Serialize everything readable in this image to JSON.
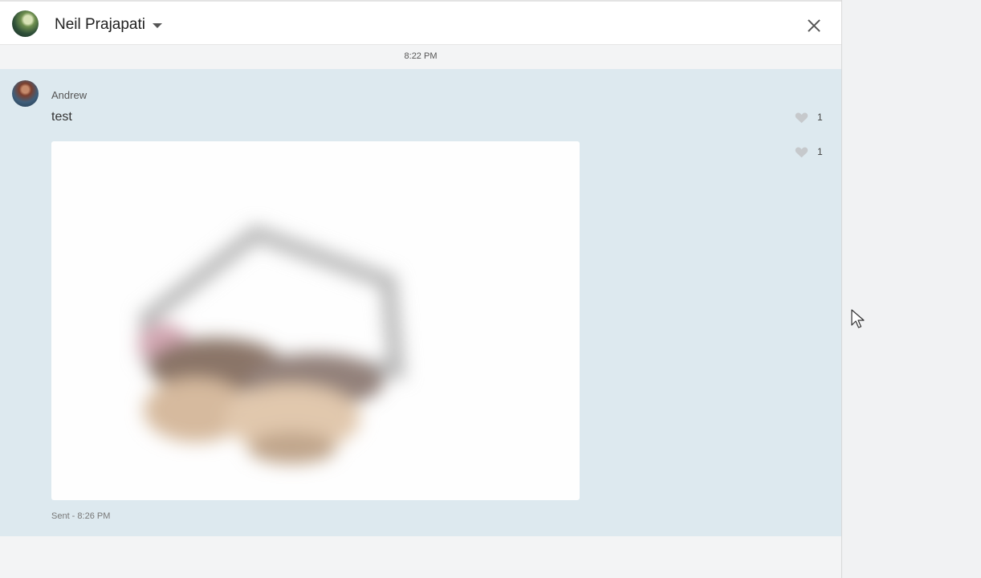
{
  "header": {
    "contact_name": "Neil Prajapati",
    "avatar_icon": "contact-avatar",
    "dropdown_icon": "caret-down-icon",
    "close_icon": "close-icon"
  },
  "timeline": {
    "divider_time": "8:22 PM"
  },
  "message": {
    "sender": "Andrew",
    "text": "test",
    "attachment_icon": "image-attachment",
    "sent_status": "Sent - 8:26 PM",
    "likes": [
      {
        "icon": "heart-icon",
        "count": "1"
      },
      {
        "icon": "heart-icon",
        "count": "1"
      }
    ]
  },
  "colors": {
    "header_bg": "#ffffff",
    "message_bg": "#dde9ef",
    "page_bg": "#f3f4f5"
  }
}
